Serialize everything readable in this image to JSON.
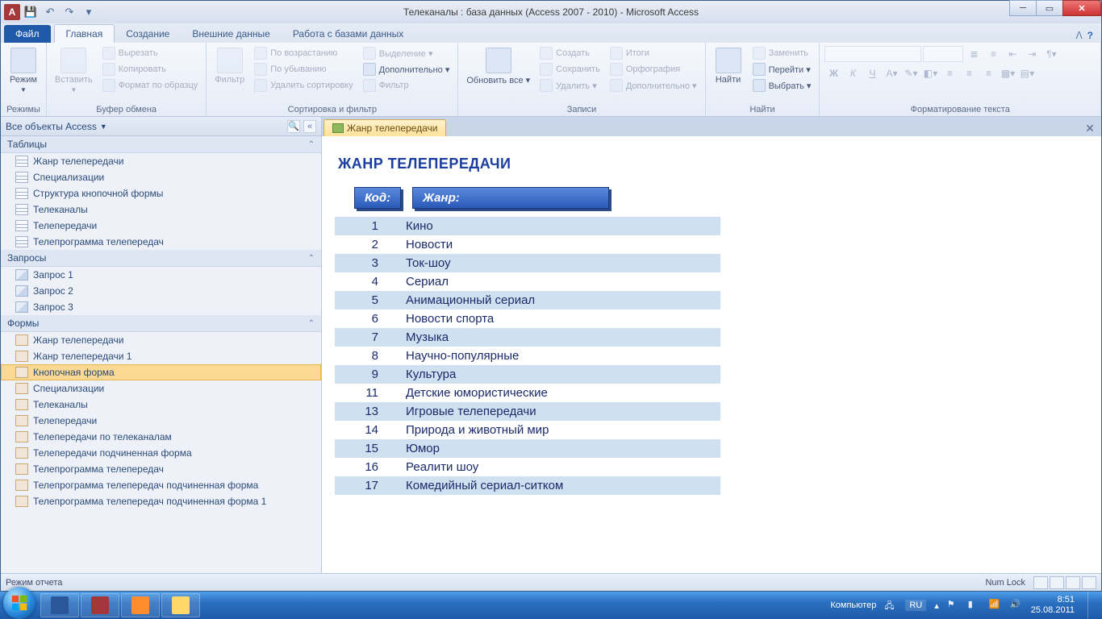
{
  "titlebar": {
    "title": "Телеканалы : база данных (Access 2007 - 2010)  -  Microsoft Access"
  },
  "ribbon": {
    "file": "Файл",
    "tabs": [
      "Главная",
      "Создание",
      "Внешние данные",
      "Работа с базами данных"
    ],
    "groups": {
      "modes": {
        "title": "Режимы",
        "mode": "Режим"
      },
      "clipboard": {
        "title": "Буфер обмена",
        "paste": "Вставить",
        "cut": "Вырезать",
        "copy": "Копировать",
        "formatpainter": "Формат по образцу"
      },
      "sortfilter": {
        "title": "Сортировка и фильтр",
        "filter": "Фильтр",
        "asc": "По возрастанию",
        "desc": "По убыванию",
        "clearsort": "Удалить сортировку",
        "selection": "Выделение ▾",
        "advanced": "Дополнительно ▾",
        "toggle": "Фильтр"
      },
      "records": {
        "title": "Записи",
        "refresh": "Обновить все ▾",
        "new": "Создать",
        "save": "Сохранить",
        "delete": "Удалить ▾",
        "totals": "Итоги",
        "spelling": "Орфография",
        "more": "Дополнительно ▾"
      },
      "find": {
        "title": "Найти",
        "find": "Найти",
        "replace": "Заменить",
        "goto": "Перейти ▾",
        "select": "Выбрать ▾"
      },
      "format": {
        "title": "Форматирование текста"
      }
    }
  },
  "nav": {
    "title": "Все объекты Access",
    "groups": [
      {
        "name": "Таблицы",
        "type": "tbl",
        "items": [
          "Жанр телепередачи",
          "Специализации",
          "Структура кнопочной формы",
          "Телеканалы",
          "Телепередачи",
          "Телепрограмма телепередач"
        ]
      },
      {
        "name": "Запросы",
        "type": "qry",
        "items": [
          "Запрос 1",
          "Запрос 2",
          "Запрос 3"
        ]
      },
      {
        "name": "Формы",
        "type": "frm",
        "items": [
          "Жанр телепередачи",
          "Жанр телепередачи 1",
          "Кнопочная форма",
          "Специализации",
          "Телеканалы",
          "Телепередачи",
          "Телепередачи по телеканалам",
          "Телепередачи подчиненная форма",
          "Телепрограмма телепередач",
          "Телепрограмма телепередач подчиненная форма",
          "Телепрограмма телепередач подчиненная форма 1"
        ]
      }
    ],
    "selected": "Кнопочная форма"
  },
  "doc": {
    "tab": "Жанр телепередачи",
    "title": "ЖАНР ТЕЛЕПЕРЕДАЧИ",
    "headers": {
      "code": "Код:",
      "genre": "Жанр:"
    },
    "rows": [
      {
        "code": 1,
        "genre": "Кино"
      },
      {
        "code": 2,
        "genre": "Новости"
      },
      {
        "code": 3,
        "genre": "Ток-шоу"
      },
      {
        "code": 4,
        "genre": "Сериал"
      },
      {
        "code": 5,
        "genre": "Анимационный сериал"
      },
      {
        "code": 6,
        "genre": "Новости спорта"
      },
      {
        "code": 7,
        "genre": "Музыка"
      },
      {
        "code": 8,
        "genre": "Научно-популярные"
      },
      {
        "code": 9,
        "genre": "Культура"
      },
      {
        "code": 11,
        "genre": "Детские юмористические"
      },
      {
        "code": 13,
        "genre": "Игровые телепередачи"
      },
      {
        "code": 14,
        "genre": "Природа и животный мир"
      },
      {
        "code": 15,
        "genre": "Юмор"
      },
      {
        "code": 16,
        "genre": "Реалити шоу"
      },
      {
        "code": 17,
        "genre": "Комедийный сериал-ситком"
      }
    ]
  },
  "status": {
    "mode": "Режим отчета",
    "numlock": "Num Lock"
  },
  "tray": {
    "computer": "Компьютер",
    "lang": "RU",
    "time": "8:51",
    "date": "25.08.2011"
  }
}
